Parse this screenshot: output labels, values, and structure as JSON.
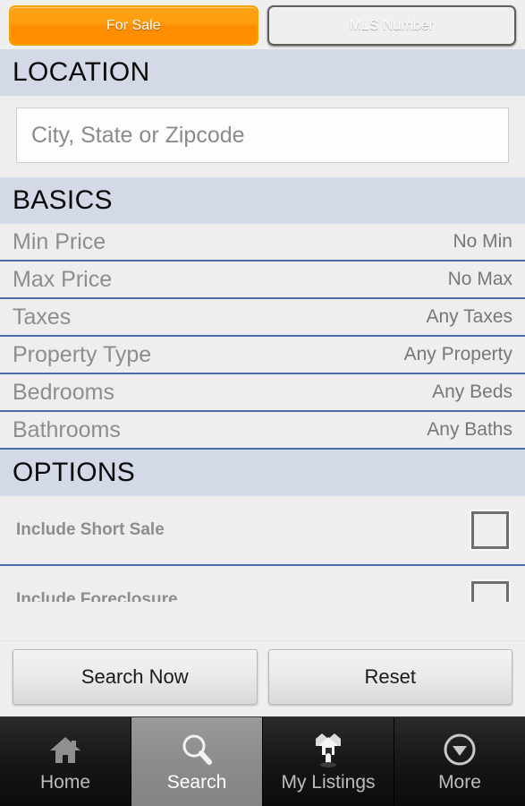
{
  "top_tabs": [
    {
      "label": "For Sale",
      "state": "active",
      "name": "tab-for-sale"
    },
    {
      "label": "MLS Number",
      "state": "inactive",
      "name": "tab-mls-number"
    }
  ],
  "location": {
    "header": "LOCATION",
    "input_placeholder": "City, State or Zipcode",
    "input_value": ""
  },
  "basics": {
    "header": "BASICS",
    "rows": [
      {
        "label": "Min Price",
        "value": "No Min"
      },
      {
        "label": "Max Price",
        "value": "No Max"
      },
      {
        "label": "Taxes",
        "value": "Any Taxes"
      },
      {
        "label": "Property Type",
        "value": "Any Property"
      },
      {
        "label": "Bedrooms",
        "value": "Any Beds"
      },
      {
        "label": "Bathrooms",
        "value": "Any Baths"
      }
    ]
  },
  "options": {
    "header": "OPTIONS",
    "items": [
      {
        "label": "Include Short Sale",
        "checked": false
      },
      {
        "label": "Include Foreclosure",
        "checked": false
      }
    ]
  },
  "actions": {
    "search_label": "Search Now",
    "reset_label": "Reset"
  },
  "nav": {
    "items": [
      {
        "label": "Home",
        "icon": "house-icon",
        "selected": false
      },
      {
        "label": "Search",
        "icon": "magnifier-icon",
        "selected": true
      },
      {
        "label": "My Listings",
        "icon": "houses-pin-icon",
        "selected": false
      },
      {
        "label": "More",
        "icon": "chevron-down-circle-icon",
        "selected": false
      }
    ]
  },
  "colors": {
    "accent_orange": "#ff8c00",
    "section_header_bg": "#d3d9e6",
    "row_divider": "#4d6ba8",
    "page_bg": "#eeeeee",
    "nav_bg": "#141414",
    "nav_selected_bg": "#8b8b8b"
  }
}
